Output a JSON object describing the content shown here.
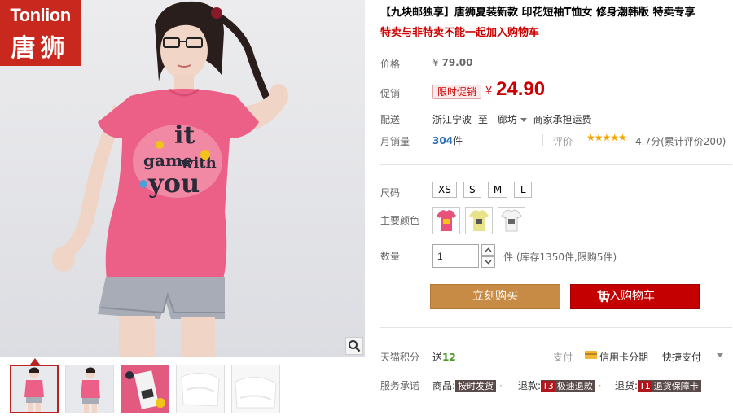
{
  "brand": {
    "logo_en": "Tonlion",
    "logo_cn": "唐狮",
    "color": "#c8281e"
  },
  "gallery": {
    "zoom_icon": "magnifier-icon",
    "thumbnails": [
      {
        "name": "thumb-pink-front",
        "active": true
      },
      {
        "name": "thumb-pink-pose",
        "active": false
      },
      {
        "name": "thumb-print-tag",
        "active": false
      },
      {
        "name": "thumb-white-fold",
        "active": false
      },
      {
        "name": "thumb-white-flat",
        "active": false
      }
    ]
  },
  "product": {
    "title": "【九块邮独享】唐狮夏装新款 印花短袖T恤女 修身潮韩版 特卖专享",
    "subtitle": "特卖与非特卖不能一起加入购物车"
  },
  "labels": {
    "price": "价格",
    "promo": "促销",
    "delivery": "配送",
    "monthly_sales": "月销量",
    "rating": "评价",
    "size": "尺码",
    "color": "主要颜色",
    "quantity": "数量",
    "points": "天猫积分",
    "payment": "支付",
    "service": "服务承诺"
  },
  "price": {
    "currency": "¥",
    "original": "79.00",
    "promo_tag": "限时促销",
    "promo_price": "24.90",
    "accent": "#c00000"
  },
  "delivery": {
    "from": "浙江宁波",
    "to_word": "至",
    "to": "廊坊",
    "fee": "商家承担运费"
  },
  "sales": {
    "count": "304",
    "unit": "件"
  },
  "rating": {
    "stars": 5,
    "stars_text": "★★★★★",
    "score_text": "4.7分(累计评价200)"
  },
  "sizes": [
    "XS",
    "S",
    "M",
    "L"
  ],
  "colors": [
    {
      "name": "pink",
      "hex": "#e8527a"
    },
    {
      "name": "yellow",
      "hex": "#e8e28a"
    },
    {
      "name": "white",
      "hex": "#f4f4f4"
    }
  ],
  "quantity": {
    "value": "1",
    "stock_text": "件 (库存1350件,限购5件)"
  },
  "buttons": {
    "buy_now": "立刻购买",
    "add_to_cart": "加入购物车",
    "buy_color": "#c88b46",
    "cart_color": "#c40000"
  },
  "points": {
    "prefix": "送",
    "value": "12"
  },
  "payment": {
    "card": "信用卡分期",
    "quick": "快捷支付"
  },
  "service": [
    {
      "label": "商品:",
      "badge_prefix": "",
      "badge": "按时发货"
    },
    {
      "label": "退款:",
      "badge_prefix": "T3",
      "badge": "极速退款"
    },
    {
      "label": "退货:",
      "badge_prefix": "T1",
      "badge": "退货保障卡"
    }
  ]
}
